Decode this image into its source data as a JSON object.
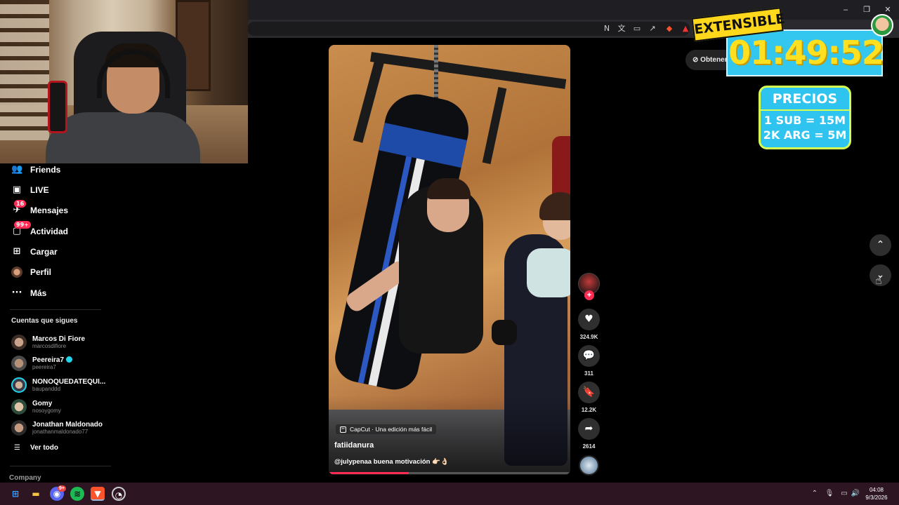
{
  "sidebar": {
    "nav": [
      {
        "label": "Friends",
        "icon": "friends-icon",
        "glyph": "👥"
      },
      {
        "label": "LIVE",
        "icon": "live-icon",
        "glyph": "▣"
      },
      {
        "label": "Mensajes",
        "icon": "messages-icon",
        "glyph": "✈",
        "badge": "16"
      },
      {
        "label": "Actividad",
        "icon": "activity-icon",
        "glyph": "▢",
        "badge": "99+"
      },
      {
        "label": "Cargar",
        "icon": "upload-icon",
        "glyph": "⊞"
      },
      {
        "label": "Perfil",
        "icon": "profile-avatar",
        "glyph": ""
      },
      {
        "label": "Más",
        "icon": "more-icon",
        "glyph": "···"
      }
    ],
    "following_title": "Cuentas que sigues",
    "following": [
      {
        "name": "Marcos Di Fiore",
        "username": "marcosdifiore",
        "verified": false
      },
      {
        "name": "Peereira7",
        "username": "peereira7",
        "verified": true
      },
      {
        "name": "NONOQUEDATEQUI...",
        "username": "baupanddd",
        "verified": false
      },
      {
        "name": "Gomy",
        "username": "nosoygomy",
        "verified": false
      },
      {
        "name": "Jonathan Maldonado",
        "username": "jonathanmaldonado77",
        "verified": false
      }
    ],
    "see_all": "Ver todo",
    "company": "Company"
  },
  "video": {
    "capcut_label": "CapCut · Una edición más fácil",
    "author": "fatiidanura",
    "caption": "@julypenaa buena motivación 👉🏻👌🏻",
    "progress": 0.33
  },
  "actions": {
    "likes": "324.9K",
    "comments": "311",
    "saves": "12.2K",
    "shares": "2614"
  },
  "get_app_label": "Obtener",
  "overlay": {
    "banner": "EXTENSIBLE",
    "timer": "01:49:52",
    "prices_title": "PRECIOS",
    "price_lines": [
      "1 SUB = 15M",
      "2K ARG = 5M"
    ]
  },
  "taskbar": {
    "time": "04:08",
    "date": "9/3/2026",
    "discord_badge": "9+"
  },
  "colors": {
    "accent": "#fe2c55",
    "timer_bg": "#33c6ee",
    "timer_text": "#ffe020",
    "price_border": "#d6ff52"
  }
}
